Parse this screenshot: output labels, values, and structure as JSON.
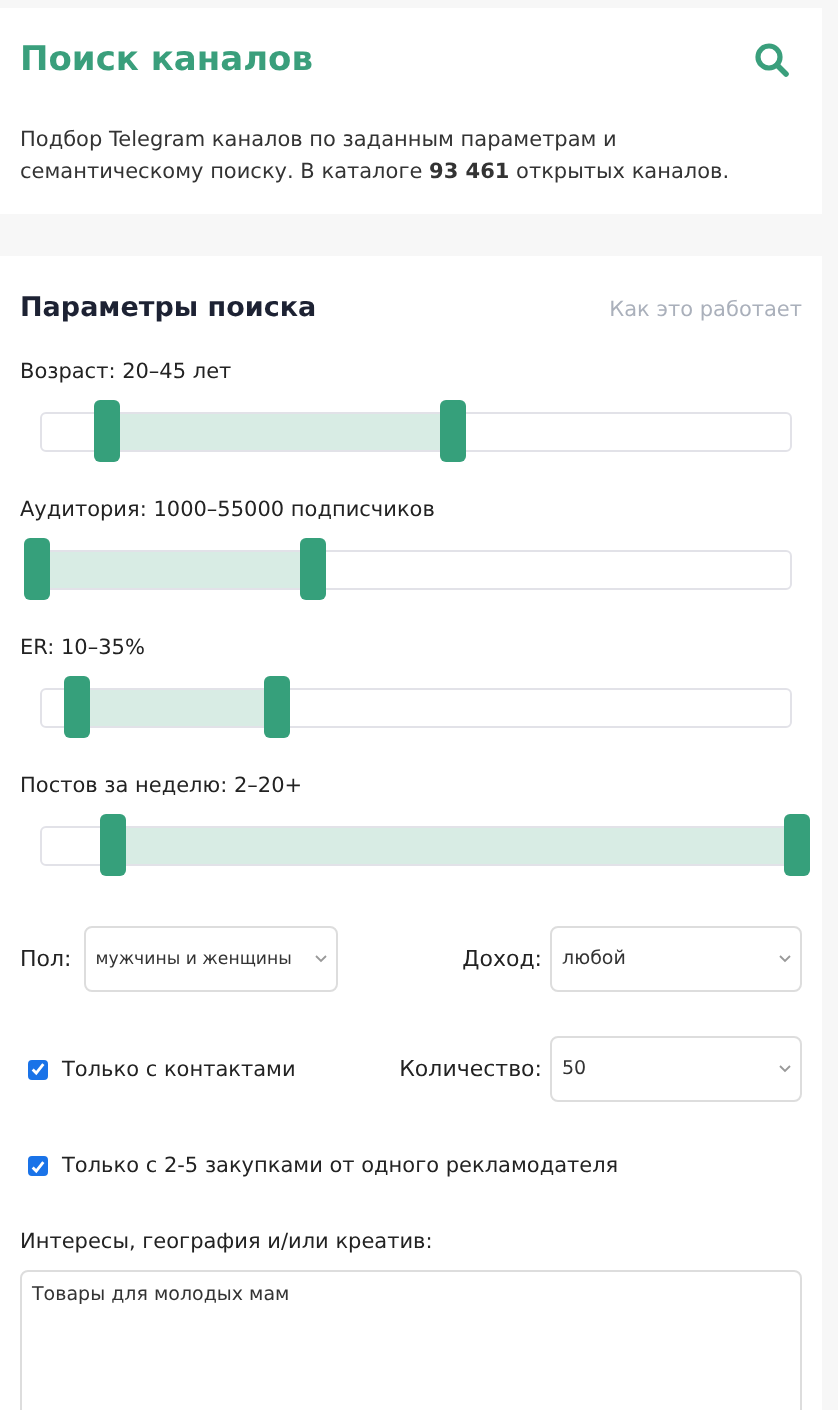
{
  "header": {
    "title": "Поиск каналов",
    "description": "Подбор Telegram каналов по заданным параметрам и семантическому поиску. В каталоге **93 461** открытых каналов."
  },
  "params": {
    "title": "Параметры поиска",
    "help_link": "Как это работает"
  },
  "sliders": [
    {
      "label": "Возраст: 20–45 лет",
      "thumbs": [
        {
          "level": 0.093
        },
        {
          "level": 0.547
        }
      ]
    },
    {
      "label": "Аудитория: 1000–55000 подписчиков",
      "thumbs": [
        {
          "level": 0
        },
        {
          "level": 0.363
        }
      ]
    },
    {
      "label": "ER: 10–35%",
      "thumbs": [
        {
          "level": 0.053
        },
        {
          "level": 0.317
        }
      ]
    },
    {
      "label": "Постов за неделю: 2–20+",
      "thumbs": [
        {
          "level": 0.101
        },
        {
          "level": 1
        }
      ]
    }
  ],
  "gender": {
    "label": "Пол:",
    "value": "мужчины и женщины"
  },
  "income": {
    "label": "Доход:",
    "value": "любой"
  },
  "contacts_only": {
    "label": "Только с контактами",
    "checked": true
  },
  "count": {
    "label": "Количество:",
    "value": "50"
  },
  "purchases_only": {
    "label": "Только с 2-5 закупками от одного рекламодателя",
    "checked": true
  },
  "interests": {
    "label": "Интересы, география и/или креатив:",
    "value": "Товары для молодых мам"
  }
}
